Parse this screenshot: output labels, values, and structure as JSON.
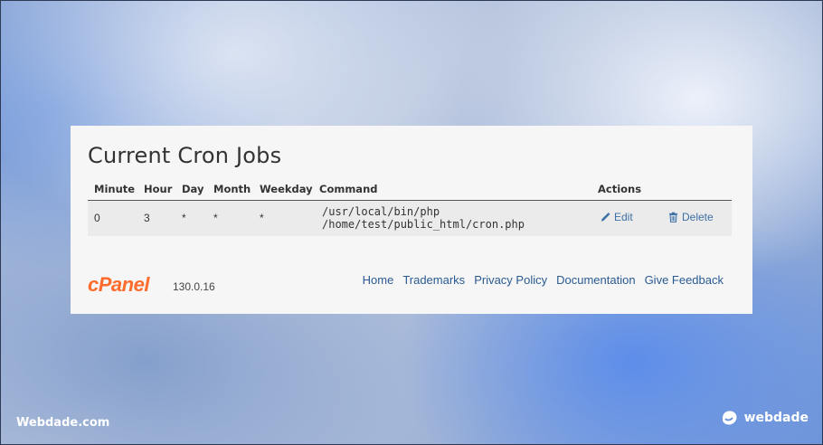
{
  "panel": {
    "title": "Current Cron Jobs",
    "table": {
      "headers": {
        "minute": "Minute",
        "hour": "Hour",
        "day": "Day",
        "month": "Month",
        "weekday": "Weekday",
        "command": "Command",
        "actions": "Actions"
      },
      "rows": [
        {
          "minute": "0",
          "hour": "3",
          "day": "*",
          "month": "*",
          "weekday": "*",
          "command": "/usr/local/bin/php /home/test/public_html/cron.php",
          "edit_label": "Edit",
          "delete_label": "Delete"
        }
      ]
    }
  },
  "footer": {
    "logo_text": "cPanel",
    "version": "130.0.16",
    "links": [
      "Home",
      "Trademarks",
      "Privacy Policy",
      "Documentation",
      "Give Feedback"
    ]
  },
  "watermarks": {
    "left": "Webdade.com",
    "right": "webdade"
  },
  "colors": {
    "link": "#2a5a92",
    "command": "#c7254e",
    "cpanel_orange": "#ff6c2c"
  },
  "icons": {
    "edit": "pencil-icon",
    "delete": "trash-icon",
    "brand": "webdade-logo-icon"
  }
}
